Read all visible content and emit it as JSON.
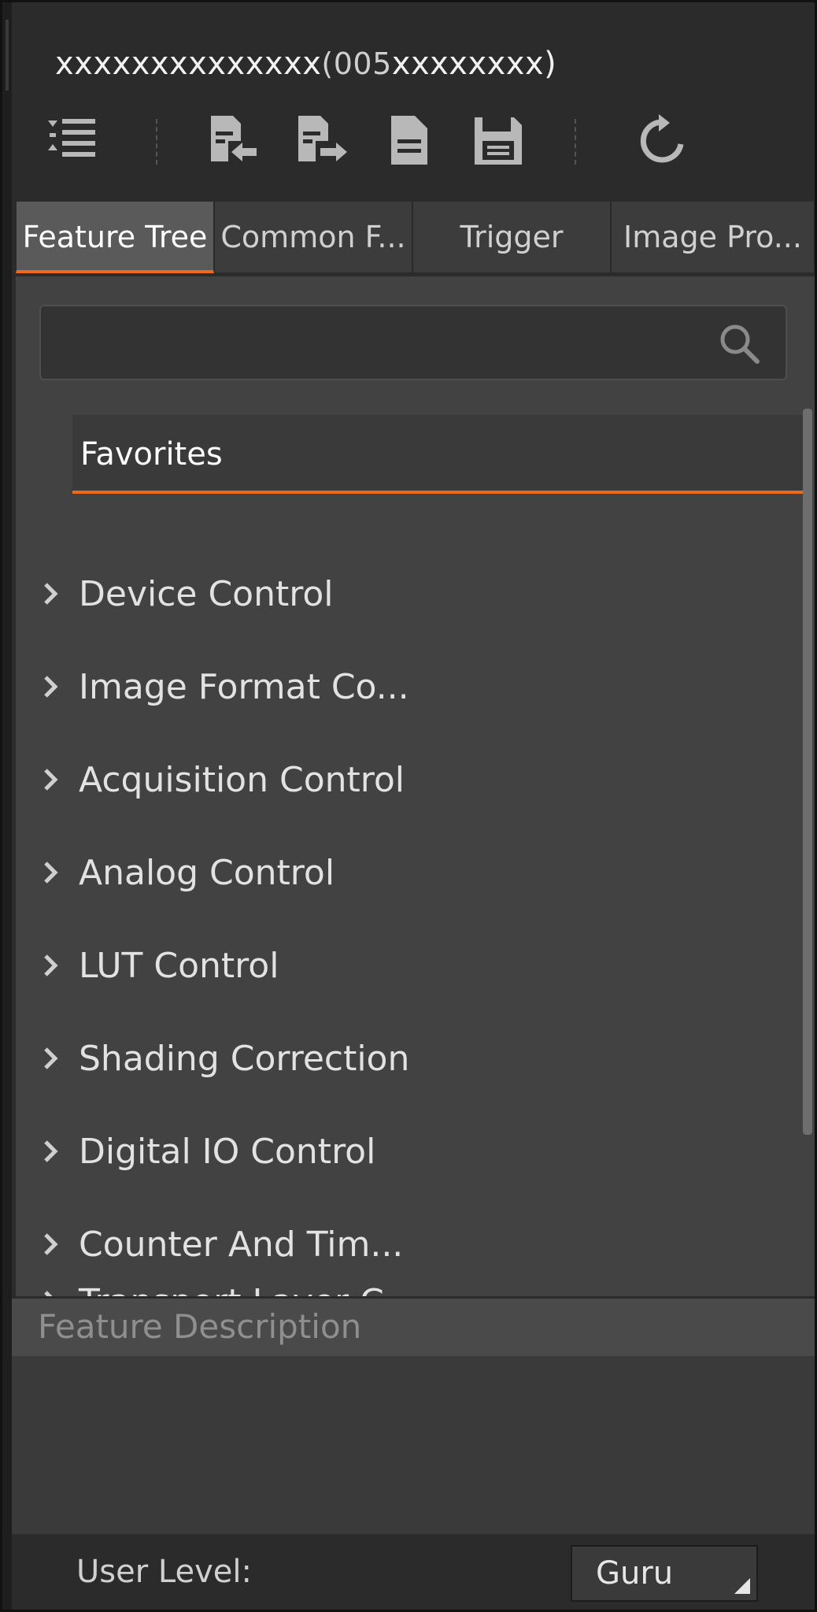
{
  "header": {
    "device_name": "xxxxxxxxxxxxxx",
    "device_serial_prefix": "(005",
    "device_serial_rest": "xxxxxxxx)"
  },
  "toolbar": {
    "icons": [
      "expand-collapse-icon",
      "import-icon",
      "export-icon",
      "document-icon",
      "save-icon",
      "refresh-icon"
    ]
  },
  "tabs": [
    {
      "label": "Feature Tree",
      "active": true
    },
    {
      "label": "Common F...",
      "active": false
    },
    {
      "label": "Trigger",
      "active": false
    },
    {
      "label": "Image Pro...",
      "active": false
    }
  ],
  "search": {
    "placeholder": "",
    "value": ""
  },
  "favorites": {
    "label": "Favorites"
  },
  "tree": {
    "items": [
      {
        "label": "Device Control"
      },
      {
        "label": "Image Format Co..."
      },
      {
        "label": "Acquisition Control"
      },
      {
        "label": "Analog Control"
      },
      {
        "label": "LUT Control"
      },
      {
        "label": "Shading Correction"
      },
      {
        "label": "Digital IO Control"
      },
      {
        "label": "Counter And Tim..."
      },
      {
        "label": "Transport Layer C..."
      }
    ]
  },
  "description": {
    "header": "Feature Description",
    "body": ""
  },
  "footer": {
    "user_level_label": "User Level:",
    "user_level_value": "Guru"
  },
  "colors": {
    "accent": "#ee6a1a",
    "panel": "#424242",
    "background": "#2b2b2b"
  }
}
